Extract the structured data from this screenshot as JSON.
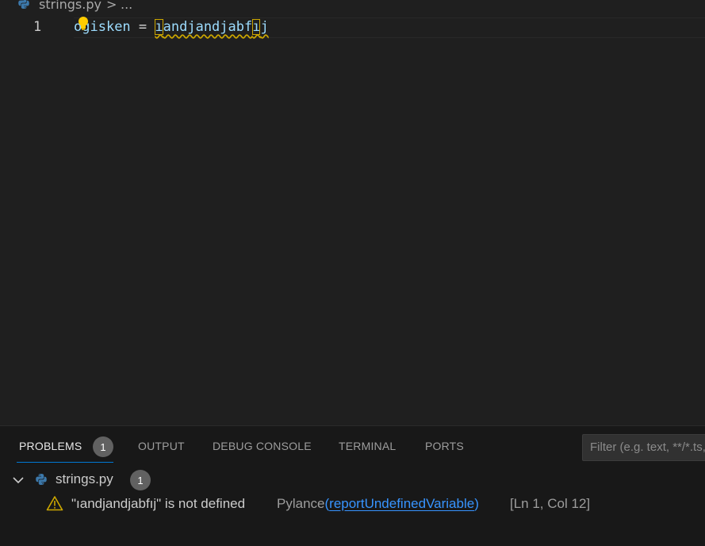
{
  "breadcrumb": {
    "file": "strings.py",
    "separator": ">",
    "more": "..."
  },
  "editor": {
    "line_number": "1",
    "code": {
      "var_prefix": "o",
      "var_rest": "gisken",
      "assign": " = ",
      "undef_first": "ı",
      "undef_mid": "andjandjabf",
      "undef_box": "ı",
      "undef_last": "j"
    }
  },
  "panel": {
    "tabs": [
      {
        "label": "PROBLEMS",
        "badge": "1",
        "active": true
      },
      {
        "label": "OUTPUT"
      },
      {
        "label": "DEBUG CONSOLE"
      },
      {
        "label": "TERMINAL"
      },
      {
        "label": "PORTS"
      }
    ],
    "filter_placeholder": "Filter (e.g. text, **/*.ts, !**/node_modules/**)",
    "problems": {
      "file": "strings.py",
      "count": "1",
      "items": [
        {
          "message": "\"ıandjandjabfıj\" is not defined",
          "source": "Pylance",
          "code": "reportUndefinedVariable",
          "position": "[Ln 1, Col 12]"
        }
      ]
    }
  },
  "colors": {
    "accent": "#0078d4",
    "warning": "#cca700",
    "link": "#3794ff",
    "python_blue": "#3c78aa"
  }
}
